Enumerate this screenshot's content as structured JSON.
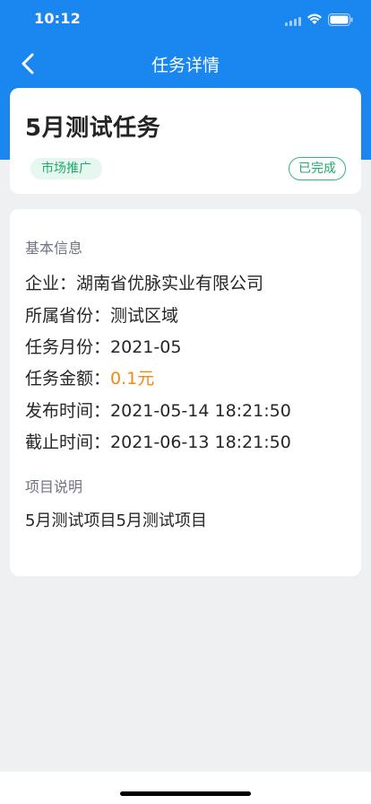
{
  "status_bar": {
    "time": "10:12",
    "icons": [
      "signal-icon",
      "wifi-icon",
      "battery-icon"
    ]
  },
  "nav": {
    "title": "任务详情",
    "back_icon": "chevron-left-icon"
  },
  "task": {
    "title": "5月测试任务",
    "category": "市场推广",
    "status": "已完成"
  },
  "basic_info": {
    "section_title": "基本信息",
    "rows": [
      {
        "label": "企业：",
        "value": "湖南省优脉实业有限公司"
      },
      {
        "label": "所属省份：",
        "value": "测试区域"
      },
      {
        "label": "任务月份：",
        "value": "2021-05"
      },
      {
        "label": "任务金额：",
        "value": "0.1元"
      },
      {
        "label": "发布时间：",
        "value": "2021-05-14 18:21:50"
      },
      {
        "label": "截止时间：",
        "value": "2021-06-13 18:21:50"
      }
    ]
  },
  "project": {
    "section_title": "项目说明",
    "description": "5月测试项目5月测试项目"
  },
  "colors": {
    "primary": "#1a86f0",
    "tag_green": "#1faa6b",
    "tag_bg": "#e5f7ef",
    "amount_orange": "#f08a12",
    "page_bg": "#eef0f2"
  }
}
